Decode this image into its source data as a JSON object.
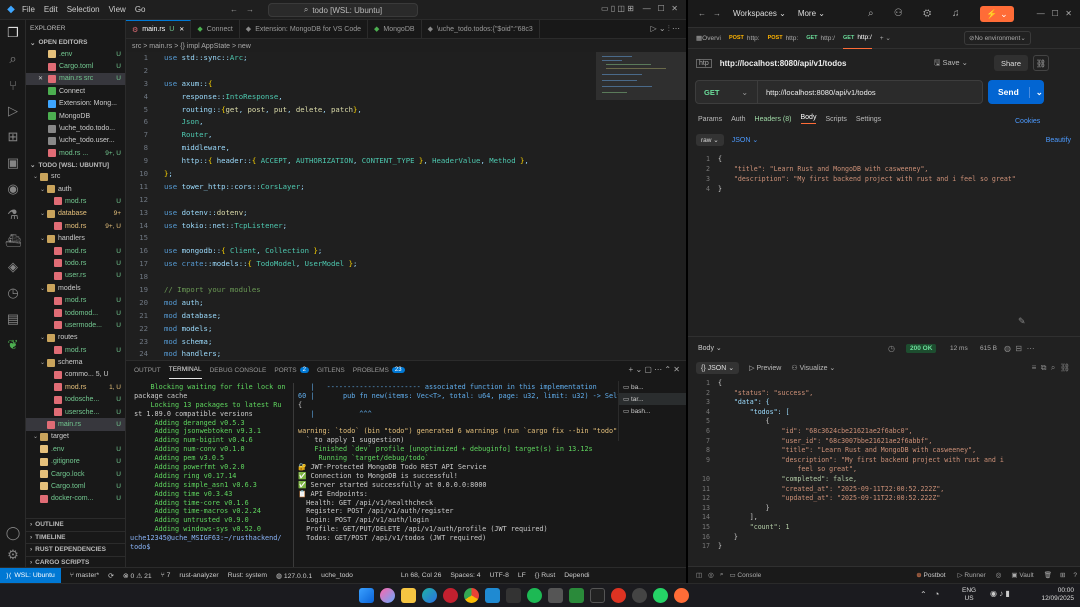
{
  "vscode": {
    "menu": [
      "File",
      "Edit",
      "Selection",
      "View",
      "Go"
    ],
    "search": "todo [WSL: Ubuntu]",
    "explorer_title": "EXPLORER",
    "open_editors_title": "OPEN EDITORS",
    "open_editors": [
      {
        "name": ".env",
        "status": "U"
      },
      {
        "name": "Cargo.toml",
        "status": "U"
      },
      {
        "name": "main.rs src",
        "status": "U"
      },
      {
        "name": "Connect",
        "status": ""
      },
      {
        "name": "Extension: Mong...",
        "status": ""
      },
      {
        "name": "MongoDB",
        "status": ""
      },
      {
        "name": "\\uche_todo.todo...",
        "status": ""
      },
      {
        "name": "\\uche_todo.user...",
        "status": ""
      },
      {
        "name": "mod.rs ...",
        "status": "9+, U"
      }
    ],
    "workspace_title": "TODO [WSL: UBUNTU]",
    "tree": [
      {
        "name": "src",
        "indent": 1,
        "folder": true
      },
      {
        "name": "auth",
        "indent": 2,
        "folder": true
      },
      {
        "name": "mod.rs",
        "indent": 3,
        "status": "U"
      },
      {
        "name": "database",
        "indent": 2,
        "folder": true,
        "status": "9+"
      },
      {
        "name": "mod.rs",
        "indent": 3,
        "status": "9+, U"
      },
      {
        "name": "handlers",
        "indent": 2,
        "folder": true
      },
      {
        "name": "mod.rs",
        "indent": 3,
        "status": "U"
      },
      {
        "name": "todo.rs",
        "indent": 3,
        "status": "U"
      },
      {
        "name": "user.rs",
        "indent": 3,
        "status": "U"
      },
      {
        "name": "models",
        "indent": 2,
        "folder": true
      },
      {
        "name": "mod.rs",
        "indent": 3,
        "status": "U"
      },
      {
        "name": "todomod...",
        "indent": 3,
        "status": "U"
      },
      {
        "name": "usermode...",
        "indent": 3,
        "status": "U"
      },
      {
        "name": "routes",
        "indent": 2,
        "folder": true
      },
      {
        "name": "mod.rs",
        "indent": 3,
        "status": "U"
      },
      {
        "name": "schema",
        "indent": 2,
        "folder": true
      },
      {
        "name": "commo... 5, U",
        "indent": 3,
        "status": ""
      },
      {
        "name": "mod.rs",
        "indent": 3,
        "status": "1, U"
      },
      {
        "name": "todosche...",
        "indent": 3,
        "status": "U"
      },
      {
        "name": "usersche...",
        "indent": 3,
        "status": "U"
      },
      {
        "name": "main.rs",
        "indent": 2,
        "status": "U",
        "selected": true
      },
      {
        "name": "target",
        "indent": 1,
        "folder": true
      },
      {
        "name": ".env",
        "indent": 1,
        "status": "U"
      },
      {
        "name": ".gitignore",
        "indent": 1,
        "status": "U"
      },
      {
        "name": "Cargo.lock",
        "indent": 1,
        "status": "U"
      },
      {
        "name": "Cargo.toml",
        "indent": 1,
        "status": "U"
      },
      {
        "name": "docker-com...",
        "indent": 1,
        "status": "U"
      }
    ],
    "bottom_sections": [
      "OUTLINE",
      "TIMELINE",
      "RUST DEPENDENCIES",
      "CARGO SCRIPTS"
    ],
    "tabs": [
      {
        "label": "main.rs",
        "status": "U",
        "active": true
      },
      {
        "label": "Connect"
      },
      {
        "label": "Extension: MongoDB for VS Code"
      },
      {
        "label": "MongoDB"
      },
      {
        "label": "\\uche_todo.todos:{\"$oid\":\"68c3"
      }
    ],
    "breadcrumb": "src > main.rs > {} impl AppState > new",
    "line_numbers": [
      "1",
      "2",
      "3",
      "4",
      "5",
      "6",
      "7",
      "8",
      "9",
      "10",
      "11",
      "12",
      "13",
      "14",
      "15",
      "16",
      "17",
      "18",
      "19",
      "20",
      "21",
      "22",
      "23",
      "24"
    ],
    "code": [
      "use std::sync::Arc;",
      "",
      "use axum::{",
      "    response::IntoResponse,",
      "    routing::{get, post, put, delete, patch},",
      "    Json,",
      "    Router,",
      "    middleware,",
      "    http::{ header::{ ACCEPT, AUTHORIZATION, CONTENT_TYPE }, HeaderValue, Method },",
      "};",
      "use tower_http::cors::CorsLayer;",
      "",
      "use dotenv::dotenv;",
      "use tokio::net::TcpListener;",
      "",
      "use mongodb::{ Client, Collection };",
      "use crate::models::{ TodoModel, UserModel };",
      "",
      "// Import your modules",
      "mod auth;",
      "mod database;",
      "mod models;",
      "mod schema;",
      "mod handlers;"
    ],
    "panel_tabs": [
      "OUTPUT",
      "TERMINAL",
      "DEBUG CONSOLE",
      "PORTS",
      "GITLENS",
      "PROBLEMS"
    ],
    "ports_count": "2",
    "problems_count": "23",
    "terminal_left": [
      "     Blocking waiting for file lock on",
      " package cache",
      "     Locking 13 packages to latest Ru",
      " st 1.89.0 compatible versions",
      "      Adding deranged v0.5.3",
      "      Adding jsonwebtoken v9.3.1",
      "      Adding num-bigint v0.4.6",
      "      Adding num-conv v0.1.0",
      "      Adding pem v3.0.5",
      "      Adding powerfmt v0.2.0",
      "      Adding ring v0.17.14",
      "      Adding simple_asn1 v0.6.3",
      "      Adding time v0.3.43",
      "      Adding time-core v0.1.6",
      "      Adding time-macros v0.2.24",
      "      Adding untrusted v0.9.0",
      "      Adding windows-sys v0.52.0",
      "uche12345@uche_MSIGF63:~/rusthackend/",
      "todo$"
    ],
    "terminal_right": [
      "   |   ----------------------- associated function in this implementation",
      "60 |       pub fn new(items: Vec<T>, total: u64, page: u32, limit: u32) -> Self",
      "{",
      "   |           ^^^",
      "",
      "warning: `todo` (bin \"todo\") generated 6 warnings (run `cargo fix --bin \"todo\"",
      "  ` to apply 1 suggestion)",
      "    Finished `dev` profile [unoptimized + debuginfo] target(s) in 13.12s",
      "     Running `target/debug/todo`",
      "🔐 JWT-Protected MongoDB Todo REST API Service",
      "✅ Connection to MongoDB is successful!",
      "✅ Server started successfully at 0.0.0.0:8000",
      "📋 API Endpoints:",
      "  Health: GET /api/v1/healthcheck",
      "  Register: POST /api/v1/auth/register",
      "  Login: POST /api/v1/auth/login",
      "  Profile: GET/PUT/DELETE /api/v1/auth/profile (JWT required)",
      "  Todos: GET/POST /api/v1/todos (JWT required)",
      ""
    ],
    "terminal_list": [
      "ba...",
      "tar...",
      "bash..."
    ],
    "status": {
      "remote": "WSL: Ubuntu",
      "branch": "master*",
      "errors": "0",
      "warnings": "21",
      "ports": "7",
      "analyzer": "rust-analyzer",
      "toolchain": "Rust: system",
      "host": "127.0.0.1",
      "project": "uche_todo",
      "position": "Ln 68, Col 26",
      "spaces": "Spaces: 4",
      "encoding": "UTF-8",
      "eol": "LF",
      "language": "Rust",
      "extra": "Dependi"
    }
  },
  "postman": {
    "workspaces": "Workspaces",
    "more": "More",
    "top_tabs": [
      {
        "label": "Overvi"
      },
      {
        "method": "POST",
        "label": "http:"
      },
      {
        "method": "POST",
        "label": "http:"
      },
      {
        "method": "GET",
        "label": "http:/"
      },
      {
        "method": "GET",
        "label": "http:/",
        "active": true
      }
    ],
    "environment": "No environment",
    "request_name": "http://localhost:8080/api/v1/todos",
    "save_label": "Save",
    "share_label": "Share",
    "method": "GET",
    "url": "http://localhost:8080/api/v1/todos",
    "send_label": "Send",
    "request_tabs": [
      "Params",
      "Auth",
      "Headers (8)",
      "Body",
      "Scripts",
      "Settings"
    ],
    "cookies": "Cookies",
    "beautify": "Beautify",
    "body_mode": "raw",
    "body_type": "JSON",
    "body_lines": [
      "{",
      "    \"title\": \"Learn Rust and MongoDB with casweeney\",",
      "    \"description\": \"My first backend project with rust and i feel so great\"",
      "}"
    ],
    "response": {
      "label": "Body",
      "status": "200 OK",
      "time": "12 ms",
      "size": "615 B",
      "format": "JSON",
      "preview": "Preview",
      "visualize": "Visualize",
      "lines": [
        "{",
        "    \"status\": \"success\",",
        "    \"data\": {",
        "        \"todos\": [",
        "            {",
        "                \"id\": \"68c3624cbe21621ae2f6abc0\",",
        "                \"user_id\": \"68c3007bbe21621ae2f6abbf\",",
        "                \"title\": \"Learn Rust and MongoDB with casweeney\",",
        "                \"description\": \"My first backend project with rust and i",
        "                    feel so great\",",
        "                \"completed\": false,",
        "                \"created_at\": \"2025-09-11T22:00:52.222Z\",",
        "                \"updated_at\": \"2025-09-11T22:00:52.222Z\"",
        "            }",
        "        ],",
        "        \"count\": 1",
        "    }",
        "}"
      ]
    },
    "statusbar": [
      "Console",
      "Postbot",
      "Runner",
      "Vault"
    ]
  },
  "taskbar": {
    "lang": "ENG",
    "region": "US",
    "time": "00:00",
    "date": "12/09/2025"
  }
}
